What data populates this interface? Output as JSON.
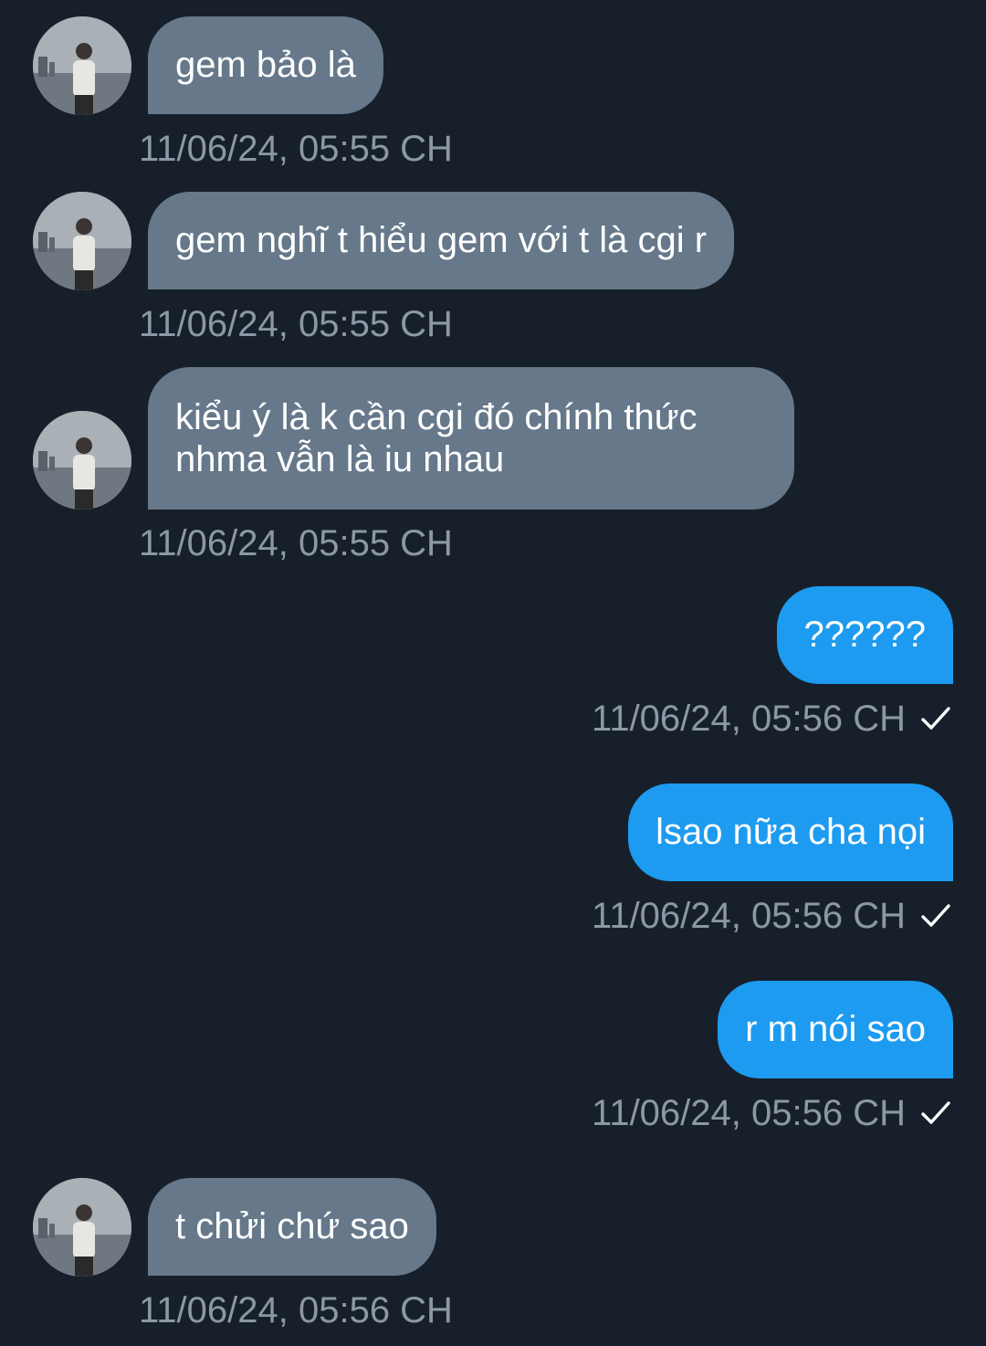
{
  "messages": [
    {
      "direction": "incoming",
      "text": "gem bảo là",
      "timestamp": "11/06/24, 05:55 CH"
    },
    {
      "direction": "incoming",
      "text": "gem nghĩ t hiểu gem với t là cgi r",
      "timestamp": "11/06/24, 05:55 CH"
    },
    {
      "direction": "incoming",
      "text": "kiểu ý là k cần cgi đó chính thức nhma vẫn là iu nhau",
      "timestamp": "11/06/24, 05:55 CH"
    },
    {
      "direction": "outgoing",
      "text": "??????",
      "timestamp": "11/06/24, 05:56 CH",
      "status_icon": "check-icon"
    },
    {
      "direction": "outgoing",
      "text": "lsao nữa cha nọi",
      "timestamp": "11/06/24, 05:56 CH",
      "status_icon": "check-icon"
    },
    {
      "direction": "outgoing",
      "text": "r m nói sao",
      "timestamp": "11/06/24, 05:56 CH",
      "status_icon": "check-icon"
    },
    {
      "direction": "incoming",
      "text": "t chửi chứ sao",
      "timestamp": "11/06/24, 05:56 CH"
    }
  ],
  "colors": {
    "background": "#17202a",
    "incoming_bubble": "#66788a",
    "outgoing_bubble": "#1d9bf0",
    "timestamp": "#8b98a5"
  }
}
